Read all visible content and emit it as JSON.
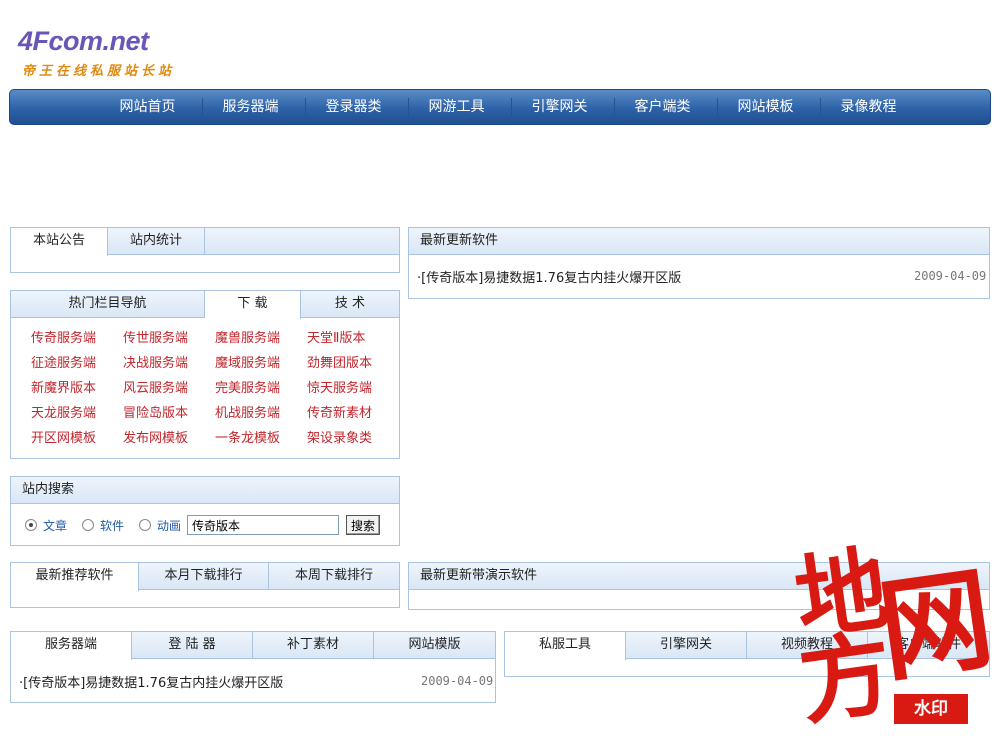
{
  "logo": {
    "main_num": "4",
    "main_text": "Fcom.net",
    "sub": "帝王在线私服站长站"
  },
  "nav": [
    "网站首页",
    "服务器端",
    "登录器类",
    "网游工具",
    "引擎网关",
    "客户端类",
    "网站模板",
    "录像教程"
  ],
  "notice_box": {
    "tabs": [
      "本站公告",
      "站内统计"
    ]
  },
  "latest_software": {
    "title": "最新更新软件",
    "items": [
      {
        "text": "·[传奇版本]易捷数据1.76复古内挂火爆开区版",
        "date": "2009-04-09"
      }
    ]
  },
  "hot_nav": {
    "tabs": [
      "热门栏目导航",
      "下 载",
      "技 术"
    ],
    "links": [
      "传奇服务端",
      "传世服务端",
      "魔兽服务端",
      "天堂Ⅱ版本",
      "征途服务端",
      "决战服务端",
      "魔域服务端",
      "劲舞团版本",
      "新魔界版本",
      "风云服务端",
      "完美服务端",
      "惊天服务端",
      "天龙服务端",
      "冒险岛版本",
      "机战服务端",
      "传奇新素材",
      "开区网模板",
      "发布网模板",
      "一条龙模板",
      "架设录象类"
    ]
  },
  "search": {
    "title": "站内搜索",
    "options": [
      "文章",
      "软件",
      "动画"
    ],
    "selected": "文章",
    "input_value": "传奇版本",
    "button": "搜索"
  },
  "ranking_box": {
    "tabs": [
      "最新推荐软件",
      "本月下载排行",
      "本周下载排行"
    ]
  },
  "demo_box": {
    "title": "最新更新带演示软件"
  },
  "server_box": {
    "tabs": [
      "服务器端",
      "登 陆 器",
      "补丁素材",
      "网站模版"
    ],
    "items": [
      {
        "text": "·[传奇版本]易捷数据1.76复古内挂火爆开区版",
        "date": "2009-04-09"
      }
    ]
  },
  "tools_box": {
    "tabs": [
      "私服工具",
      "引擎网关",
      "视频教程",
      "客户端软件"
    ]
  },
  "watermark": {
    "text1": "地",
    "text2": "方",
    "text3": "网",
    "badge": "水印",
    "color": "#d81a12"
  }
}
